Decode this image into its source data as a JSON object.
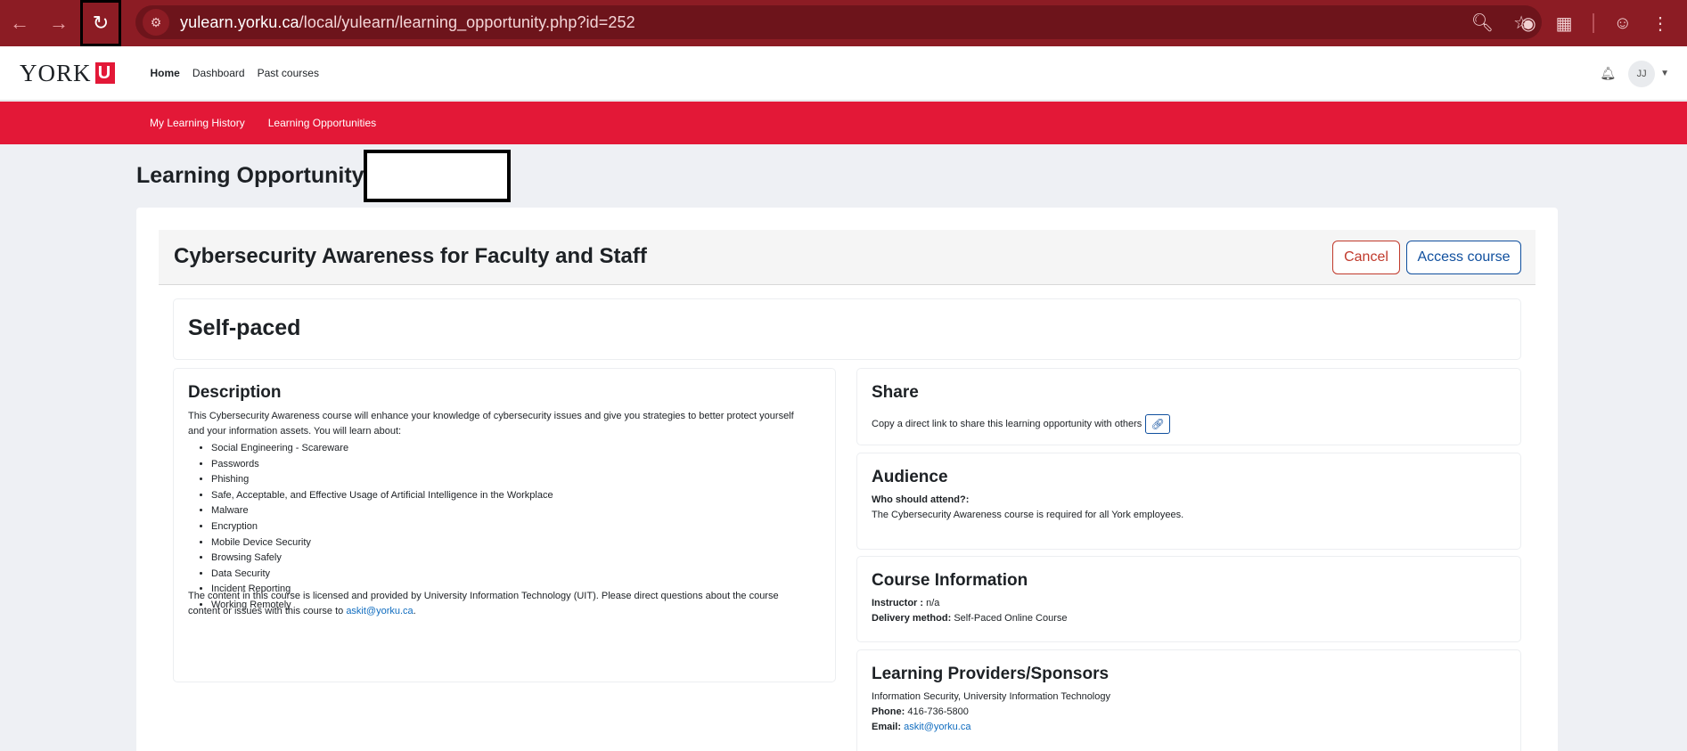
{
  "browser": {
    "url_host": "yulearn.yorku.ca",
    "url_path": "/local/yulearn/learning_opportunity.php?id=252"
  },
  "header": {
    "logo_text": "YORK",
    "logo_mark": "U",
    "nav": [
      "Home",
      "Dashboard",
      "Past courses"
    ],
    "user_initials": "JJ"
  },
  "sub_nav": [
    "My Learning History",
    "Learning Opportunities"
  ],
  "page_title": "Learning Opportunity:",
  "course": {
    "title": "Cybersecurity Awareness for Faculty and Staff",
    "cancel_label": "Cancel",
    "access_label": "Access course",
    "pace": "Self-paced"
  },
  "description": {
    "heading": "Description",
    "intro": "This Cybersecurity Awareness course will enhance your knowledge of cybersecurity issues and give you strategies to better protect yourself and your information assets. You will learn about:",
    "topics": [
      "Social Engineering - Scareware",
      "Passwords",
      "Phishing",
      "Safe, Acceptable, and Effective Usage of Artificial Intelligence in the Workplace",
      "Malware",
      "Encryption",
      "Mobile Device Security",
      "Browsing Safely",
      "Data Security",
      "Incident Reporting",
      "Working Remotely"
    ],
    "outro": "The content in this course is licensed and provided by University Information Technology (UIT). Please direct questions about the course content or issues with this course to",
    "outro_email": "askit@yorku.ca",
    "outro_end": "."
  },
  "share": {
    "heading": "Share",
    "text": "Copy a direct link to share this learning opportunity with others"
  },
  "audience": {
    "heading": "Audience",
    "question": "Who should attend?:",
    "answer": "The Cybersecurity Awareness course is required for all York employees."
  },
  "course_info": {
    "heading": "Course Information",
    "instructor_label": "Instructor :",
    "instructor_value": "n/a",
    "delivery_label": "Delivery method:",
    "delivery_value": "Self-Paced Online Course"
  },
  "providers": {
    "heading": "Learning Providers/Sponsors",
    "name": "Information Security, University Information Technology",
    "phone_label": "Phone:",
    "phone_value": "416-736-5800",
    "email_label": "Email:",
    "email_value": "askit@yorku.ca"
  }
}
